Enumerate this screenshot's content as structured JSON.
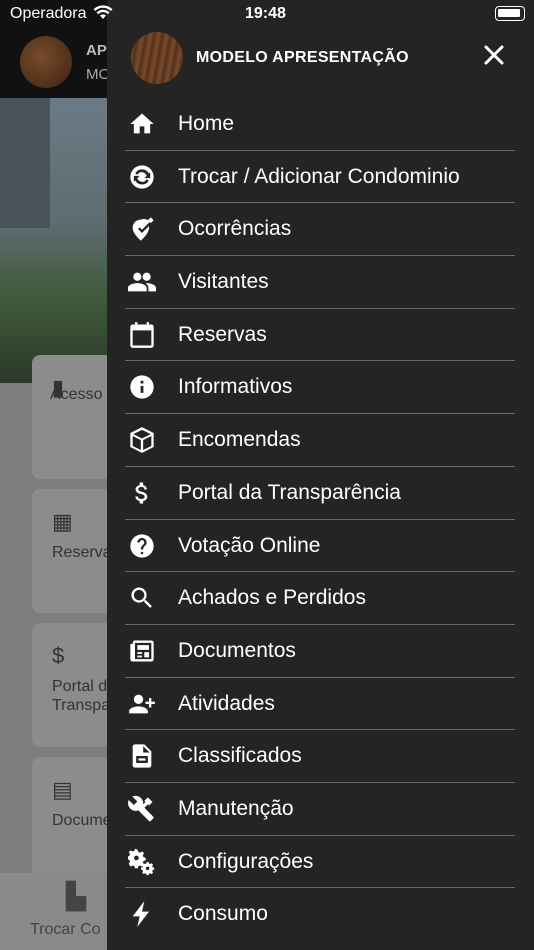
{
  "status_bar": {
    "carrier": "Operadora",
    "time": "19:48"
  },
  "background": {
    "title": "AP",
    "subtitle": "MO",
    "tiles": [
      {
        "label": "Acesso"
      },
      {
        "label": "Reserva"
      },
      {
        "label": "Portal d\nTranspa"
      },
      {
        "label": "Docume"
      }
    ],
    "tab_label": "Trocar Co"
  },
  "drawer": {
    "title": "MODELO APRESENTAÇÃO",
    "close_icon": "close-icon",
    "items": [
      {
        "label": "Home",
        "icon": "home-icon"
      },
      {
        "label": "Trocar / Adicionar Condominio",
        "icon": "swap-icon"
      },
      {
        "label": "Ocorrências",
        "icon": "report-icon"
      },
      {
        "label": "Visitantes",
        "icon": "people-icon"
      },
      {
        "label": "Reservas",
        "icon": "calendar-icon"
      },
      {
        "label": "Informativos",
        "icon": "info-icon"
      },
      {
        "label": "Encomendas",
        "icon": "package-icon"
      },
      {
        "label": "Portal da Transparência",
        "icon": "dollar-icon"
      },
      {
        "label": "Votação Online",
        "icon": "help-icon"
      },
      {
        "label": "Achados e Perdidos",
        "icon": "search-icon"
      },
      {
        "label": "Documentos",
        "icon": "newspaper-icon"
      },
      {
        "label": "Atividades",
        "icon": "add-person-icon"
      },
      {
        "label": "Classificados",
        "icon": "document-icon"
      },
      {
        "label": "Manutenção",
        "icon": "tools-icon"
      },
      {
        "label": "Configurações",
        "icon": "gears-icon"
      },
      {
        "label": "Consumo",
        "icon": "bolt-icon"
      }
    ]
  }
}
